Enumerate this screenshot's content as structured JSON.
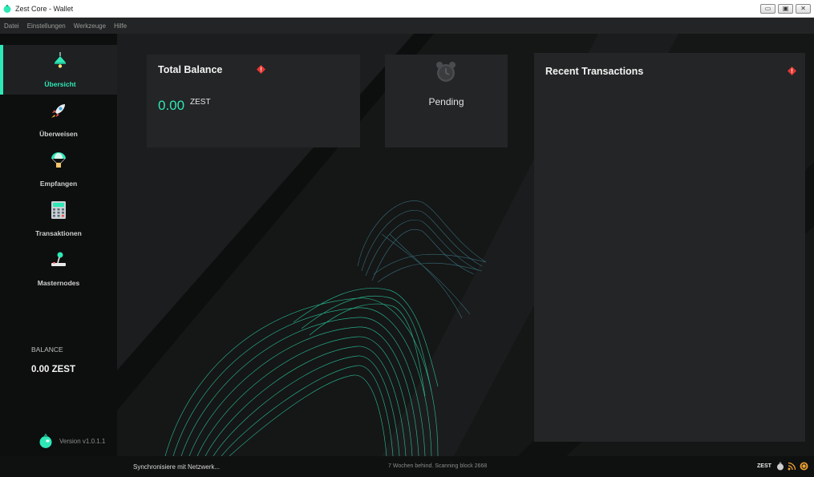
{
  "window": {
    "title": "Zest Core - Wallet",
    "app_icon": "zest-logo-icon",
    "controls": [
      "minimize-icon",
      "maximize-icon",
      "close-icon"
    ]
  },
  "menu": {
    "items": [
      "Datei",
      "Einstellungen",
      "Werkzeuge",
      "Hilfe"
    ]
  },
  "sidebar": {
    "items": [
      {
        "label": "Übersicht",
        "icon": "lamp-icon",
        "active": true
      },
      {
        "label": "Überweisen",
        "icon": "rocket-icon",
        "active": false
      },
      {
        "label": "Empfangen",
        "icon": "parachute-icon",
        "active": false
      },
      {
        "label": "Transaktionen",
        "icon": "calculator-icon",
        "active": false
      },
      {
        "label": "Masternodes",
        "icon": "joystick-icon",
        "active": false
      }
    ],
    "balance_label": "BALANCE",
    "balance_value": "0.00 ZEST",
    "version": "Version v1.0.1.1"
  },
  "overview": {
    "total_balance": {
      "title": "Total Balance",
      "amount": "0.00",
      "unit": "ZEST",
      "warning_icon": "out-of-sync-warning-icon"
    },
    "pending": {
      "label": "Pending",
      "icon": "alarm-clock-icon"
    },
    "recent_transactions": {
      "title": "Recent Transactions",
      "warning_icon": "out-of-sync-warning-icon"
    }
  },
  "statusbar": {
    "sync_text": "Synchronisiere mit Netzwerk...",
    "behind_text": "7 Wochen behind. Scanning block 2668",
    "unit": "ZEST",
    "tray_icons": [
      "hd-wallet-icon",
      "network-activity-icon",
      "syncing-icon"
    ]
  },
  "colors": {
    "accent": "#2ee8b6",
    "warning": "#e53935",
    "background": "#151616",
    "sidebar": "#0d0e0e",
    "card": "#232526"
  }
}
